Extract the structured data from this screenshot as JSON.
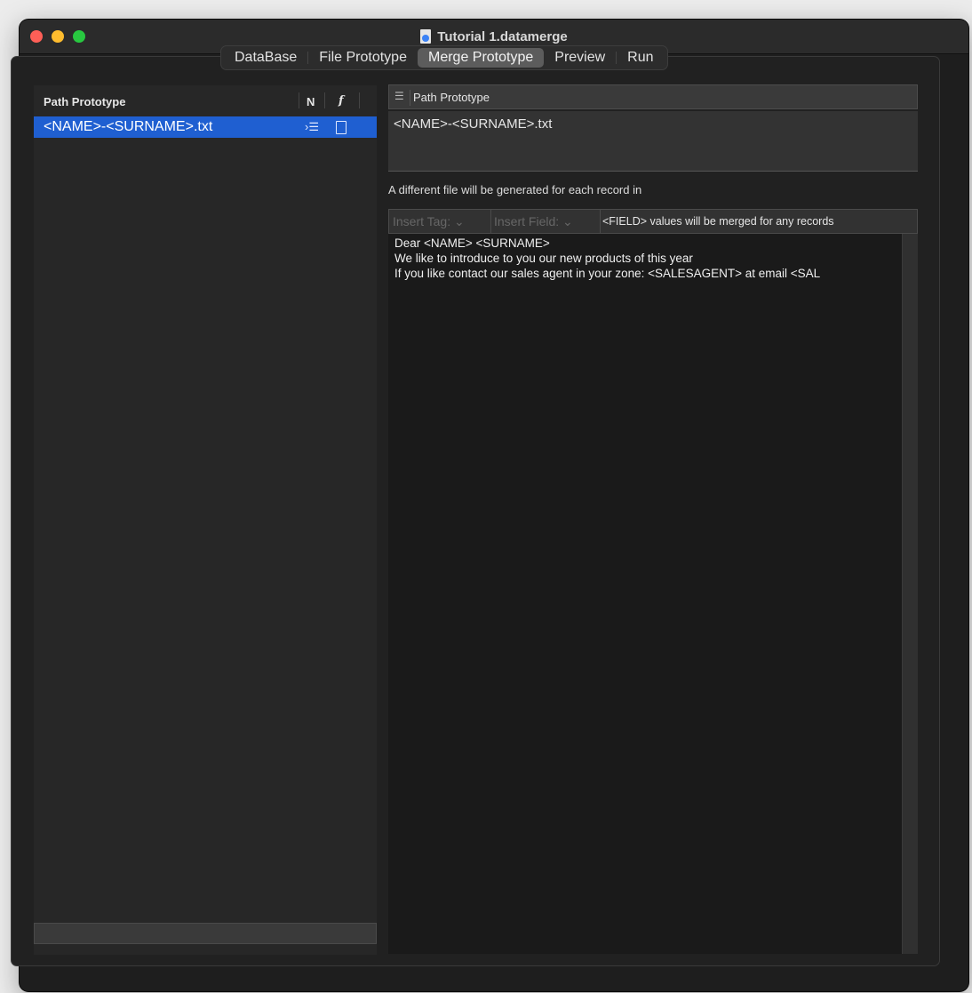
{
  "window": {
    "title": "Tutorial 1.datamerge",
    "icons": [
      "close-button",
      "minimize-button",
      "maximize-button",
      "document-icon"
    ]
  },
  "tabs": [
    {
      "label": "DataBase",
      "active": false
    },
    {
      "label": "File Prototype",
      "active": false
    },
    {
      "label": "Merge Prototype",
      "active": true
    },
    {
      "label": "Preview",
      "active": false
    },
    {
      "label": "Run",
      "active": false
    }
  ],
  "left_panel": {
    "header": {
      "name": "Path Prototype",
      "col_n": "N",
      "col_f": "f"
    },
    "rows": [
      {
        "text": "<NAME>-<SURNAME>.txt",
        "icons": [
          "list-indent-icon",
          "file-icon"
        ],
        "selected": true
      }
    ]
  },
  "right_panel": {
    "header_label": "Path Prototype",
    "path_value": "<NAME>-<SURNAME>.txt",
    "info": "A different file will be generated for each record in",
    "insert_tag": "Insert Tag:",
    "insert_field": "Insert Field:",
    "field_message": "<FIELD> values will be merged for any records",
    "editor_lines": [
      "Dear <NAME> <SURNAME>",
      "We like to introduce to you our new products of this year",
      "If you like contact our sales agent in your zone: <SALESAGENT> at email <SAL"
    ]
  },
  "colors": {
    "accent": "#1f5fd1",
    "active_tab": "#5c5c5c"
  }
}
